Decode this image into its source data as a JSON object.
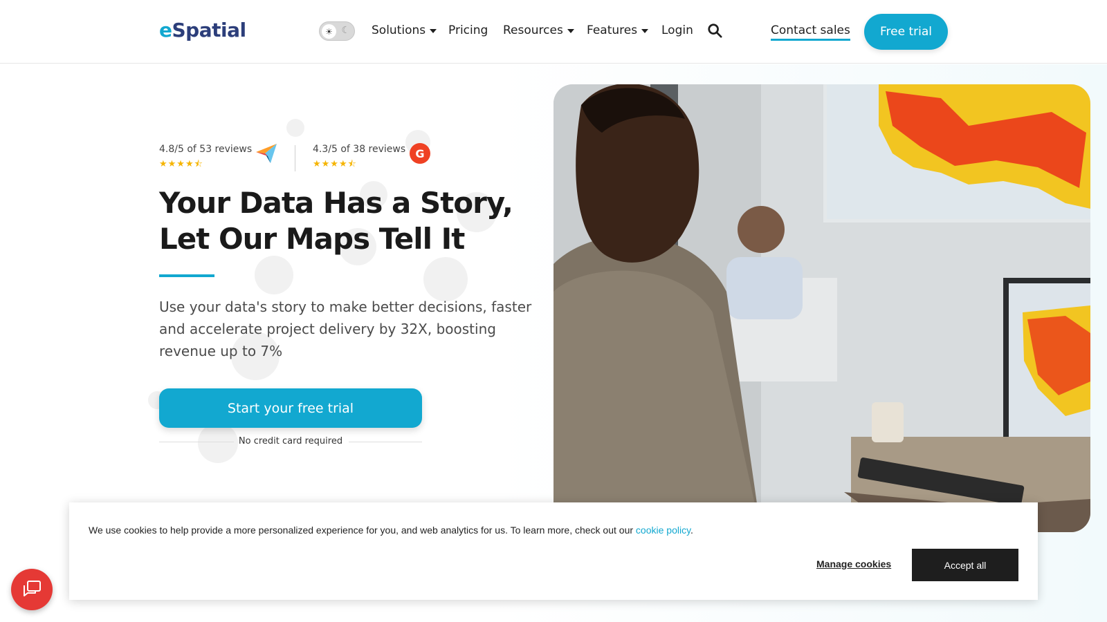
{
  "brand": {
    "logo_e": "e",
    "logo_rest": "Spatial"
  },
  "nav": {
    "solutions": "Solutions",
    "pricing": "Pricing",
    "resources": "Resources",
    "features": "Features",
    "login": "Login",
    "contact_sales": "Contact sales",
    "free_trial": "Free trial",
    "theme_light_glyph": "☀",
    "theme_dark_glyph": "☾"
  },
  "reviews": [
    {
      "text": "4.8/5 of 53 reviews",
      "stars": "★★★★⯪",
      "icon": "capterra-icon"
    },
    {
      "text": "4.3/5 of 38 reviews",
      "stars": "★★★★⯪",
      "icon": "g2-icon",
      "icon_letter": "G"
    }
  ],
  "hero": {
    "title_line1": "Your Data Has a Story,",
    "title_line2": "Let Our Maps Tell It",
    "subtitle": "Use your data's story to make better decisions, faster and accelerate project delivery by 32X, boosting revenue up to 7%",
    "cta": "Start your free trial",
    "cta_note": "No credit card required"
  },
  "cookie_banner": {
    "text": "We use cookies to help provide a more personalized experience for you, and web analytics for us. To learn more, check out our ",
    "link": "cookie policy",
    "end": ".",
    "manage": "Manage cookies",
    "accept": "Accept all"
  },
  "colors": {
    "accent": "#12a8d0",
    "brand_dark": "#2c3e7a",
    "chat": "#e53935",
    "g2": "#ef4123",
    "star": "#f5b400"
  }
}
